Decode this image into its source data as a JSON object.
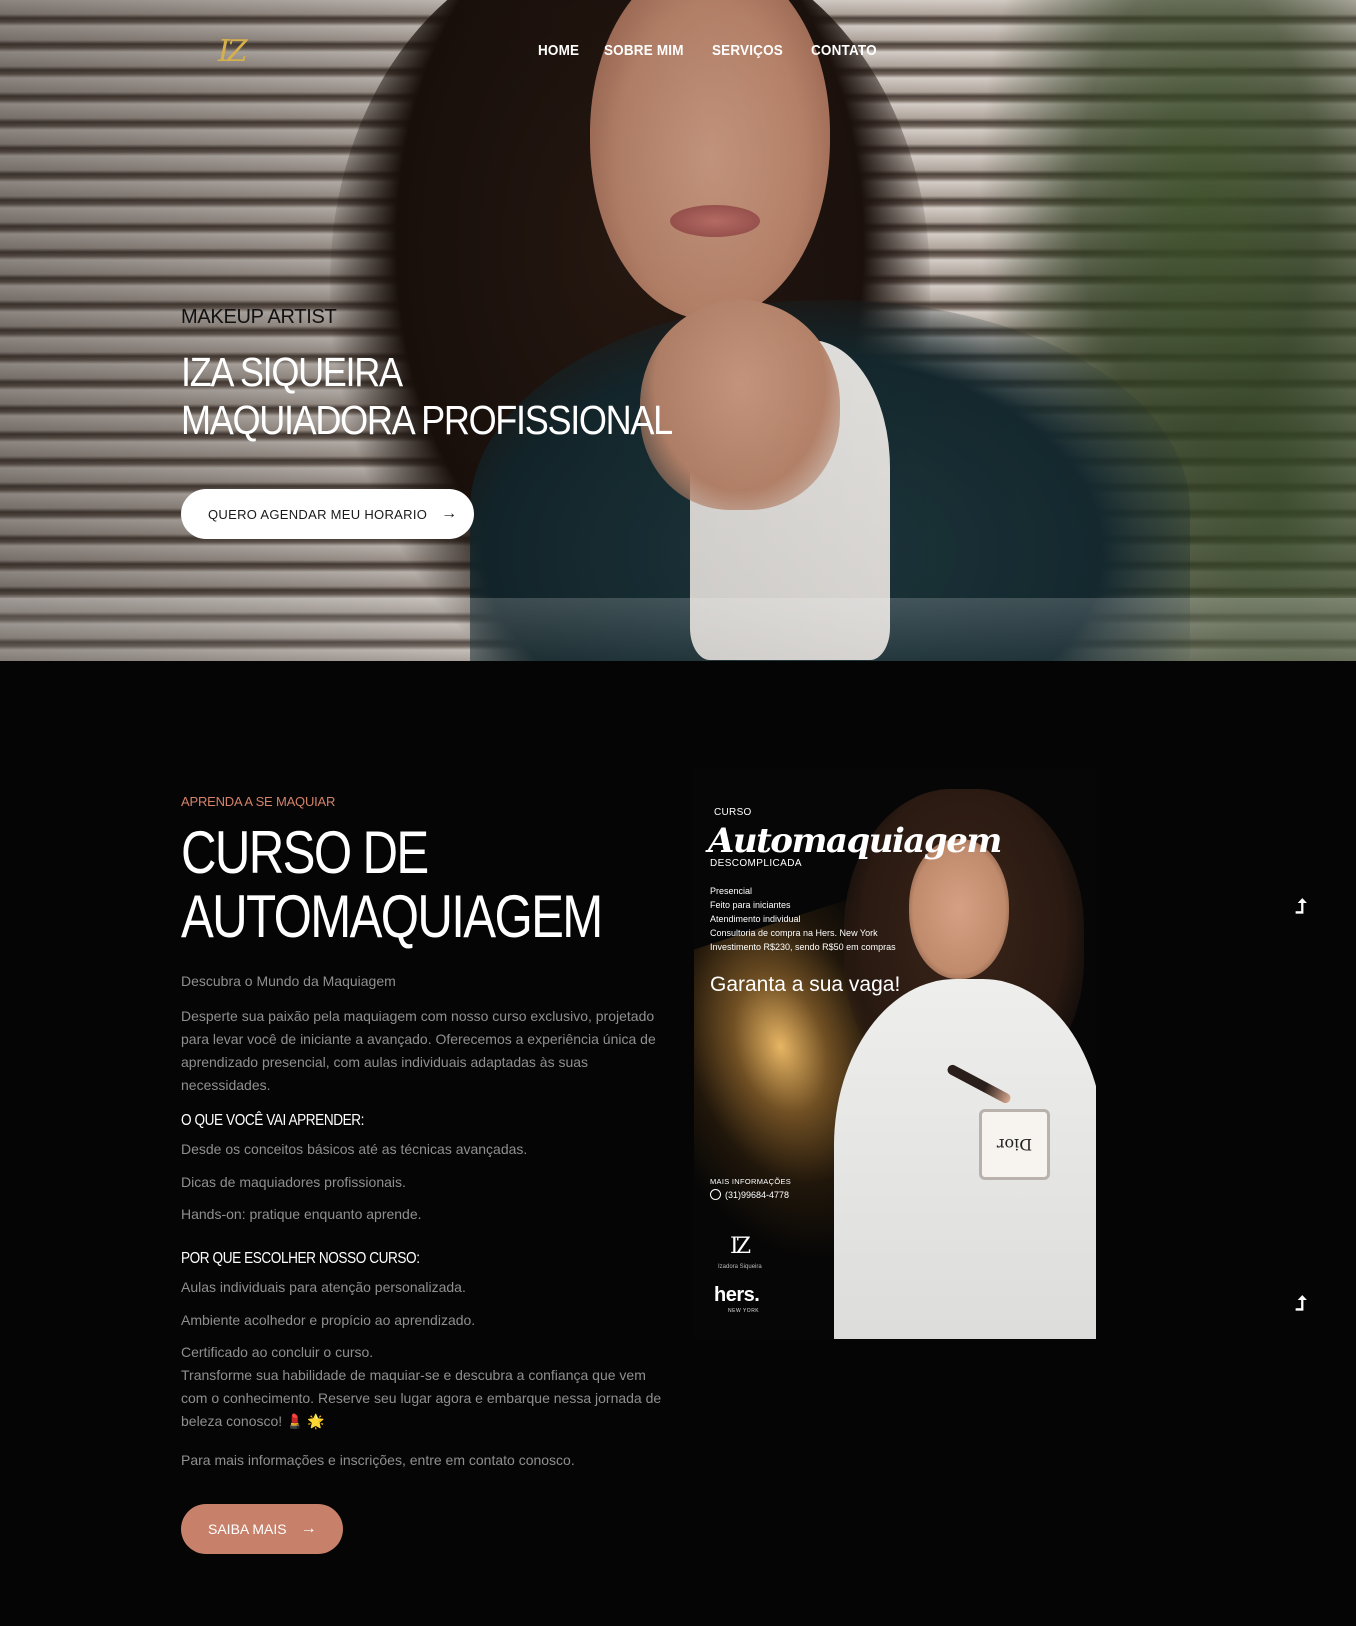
{
  "header": {
    "logo_text": "IZ",
    "nav": [
      {
        "label": "HOME"
      },
      {
        "label": "SOBRE MIM"
      },
      {
        "label": "SERVIÇOS"
      },
      {
        "label": "CONTATO"
      }
    ]
  },
  "hero": {
    "eyebrow": "MAKEUP ARTIST",
    "title_line1": "IZA SIQUEIRA",
    "title_line2": "MAQUIADORA PROFISSIONAL",
    "cta_label": "QUERO AGENDAR MEU HORARIO",
    "cta_icon": "arrow-right-icon"
  },
  "course": {
    "eyebrow": "APRENDA A SE MAQUIAR",
    "title_line1": "CURSO DE",
    "title_line2": "AUTOMAQUIAGEM",
    "intro": "Descubra o Mundo da Maquiagem",
    "description": "Desperte sua paixão pela maquiagem com nosso curso exclusivo, projetado para levar você de iniciante a avançado. Oferecemos a experiência única de aprendizado presencial, com aulas individuais adaptadas às suas necessidades.",
    "learn_heading": "O QUE VOCÊ VAI APRENDER:",
    "learn_items": [
      "Desde os conceitos básicos até as técnicas avançadas.",
      "Dicas de maquiadores profissionais.",
      "Hands-on: pratique enquanto aprende."
    ],
    "why_heading": "POR QUE ESCOLHER NOSSO CURSO:",
    "why_items": [
      "Aulas individuais para atenção personalizada.",
      "Ambiente acolhedor e propício ao aprendizado.",
      "Certificado ao concluir o curso."
    ],
    "closing": "Transforme sua habilidade de maquiar-se e descubra a confiança que vem com o conhecimento. Reserve seu lugar agora e embarque nessa jornada de beleza conosco! 💄 🌟",
    "contact_note": "Para mais informações e inscrições, entre em contato conosco.",
    "button_label": "SAIBA MAIS",
    "accent_color": "#c7806a"
  },
  "poster": {
    "curso": "CURSO",
    "script_title": "Automaquiagem",
    "subtitle": "DESCOMPLICADA",
    "items": [
      "Presencial",
      "Feito para iniciantes",
      "Atendimento individual",
      "Consultoria de compra na Hers. New York",
      "Investimento R$230, sendo R$50 em compras"
    ],
    "cta": "Garanta a sua vaga!",
    "info_label": "MAIS INFORMAÇÕES",
    "phone": "(31)99684-4778",
    "logo": "IZ",
    "logo_sub": "Izadora Siqueira",
    "hers": "hers.",
    "hers_sub": "NEW YORK",
    "compact_text": "Dior"
  },
  "scroll_buttons": [
    {
      "icon": "arrow-up-icon"
    },
    {
      "icon": "arrow-up-icon"
    }
  ]
}
